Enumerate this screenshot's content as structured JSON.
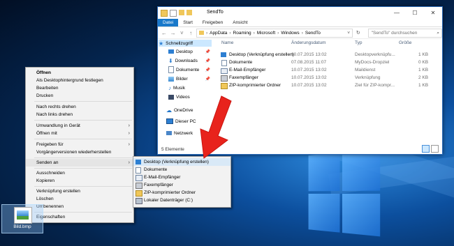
{
  "explorer": {
    "title": "SendTo",
    "ribbon_tabs": [
      "Datei",
      "Start",
      "Freigeben",
      "Ansicht"
    ],
    "breadcrumb": [
      "AppData",
      "Roaming",
      "Microsoft",
      "Windows",
      "SendTo"
    ],
    "search_placeholder": "\"SendTo\" durchsuchen",
    "nav_items": [
      {
        "label": "Schnellzugriff",
        "icon": "star-icon"
      },
      {
        "label": "Desktop",
        "icon": "desktop-icon"
      },
      {
        "label": "Downloads",
        "icon": "download-icon"
      },
      {
        "label": "Dokumente",
        "icon": "documents-icon"
      },
      {
        "label": "Bilder",
        "icon": "pictures-icon"
      },
      {
        "label": "Musik",
        "icon": "music-icon"
      },
      {
        "label": "Videos",
        "icon": "videos-icon"
      },
      {
        "label": "OneDrive",
        "icon": "cloud-icon"
      },
      {
        "label": "Dieser PC",
        "icon": "computer-icon"
      },
      {
        "label": "Netzwerk",
        "icon": "network-icon"
      }
    ],
    "columns": [
      "Name",
      "Änderungsdatum",
      "Typ",
      "Größe"
    ],
    "files": [
      {
        "name": "Desktop (Verknüpfung erstellen)",
        "date": "10.07.2015 13:02",
        "type": "Desktopverknüpfu...",
        "size": "1 KB"
      },
      {
        "name": "Dokumente",
        "date": "07.08.2015 11:07",
        "type": "MyDocs-Dropziel",
        "size": "0 KB"
      },
      {
        "name": "E-Mail-Empfänger",
        "date": "10.07.2015 13:02",
        "type": "Maildienst",
        "size": "1 KB"
      },
      {
        "name": "Faxempfänger",
        "date": "10.07.2015 13:02",
        "type": "Verknüpfung",
        "size": "2 KB"
      },
      {
        "name": "ZIP-komprimierter Ordner",
        "date": "10.07.2015 13:02",
        "type": "Ziel für ZIP-kompr...",
        "size": "1 KB"
      }
    ],
    "status": "5 Elemente"
  },
  "context_menu": {
    "items": [
      "Öffnen",
      "Als Desktophintergrund festlegen",
      "Bearbeiten",
      "Drucken",
      "Nach rechts drehen",
      "Nach links drehen",
      "Umwandlung in Gerät",
      "Öffnen mit",
      "Freigeben für",
      "Vorgängerversionen wiederherstellen",
      "Senden an",
      "Ausschneiden",
      "Kopieren",
      "Verknüpfung erstellen",
      "Löschen",
      "Umbenennen",
      "Eigenschaften"
    ]
  },
  "send_to_menu": {
    "items": [
      "Desktop (Verknüpfung erstellen)",
      "Dokumente",
      "E-Mail-Empfänger",
      "Faxempfänger",
      "ZIP-komprimierter Ordner",
      "Lokaler Datenträger (C:)"
    ]
  },
  "desktop_file": {
    "label": "Bild.bmp"
  },
  "colors": {
    "accent": "#1979ca",
    "arrow": "#e8231c",
    "desktop": "#0c4f9e"
  }
}
